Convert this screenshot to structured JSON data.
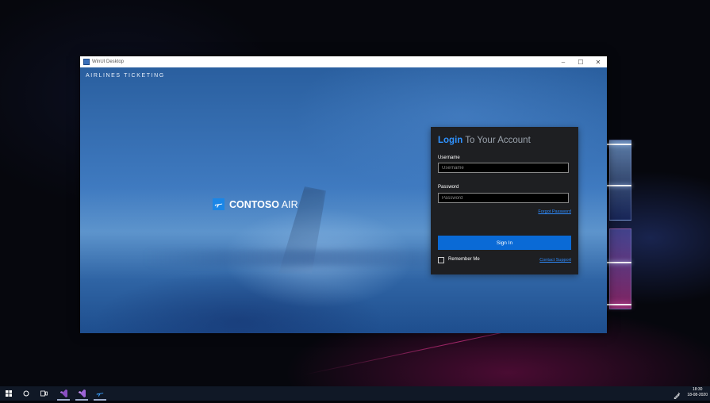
{
  "window": {
    "title": "WinUI Desktop",
    "controls": {
      "minimize": "–",
      "maximize": "☐",
      "close": "✕"
    }
  },
  "hero": {
    "tagline": "AIRLINES TICKETING",
    "brand_main": "CONTOSO",
    "brand_suffix": " AIR"
  },
  "login": {
    "title_accent": "Login",
    "title_rest": " To Your Account",
    "username_label": "Username",
    "username_placeholder": "Username",
    "username_value": "",
    "password_label": "Password",
    "password_placeholder": "Password",
    "password_value": "",
    "forgot_password": "Forgot Password",
    "sign_in": "Sign In",
    "remember_me": "Remember Me",
    "remember_checked": false,
    "contact_support": "Contact Support",
    "accent_color": "#2f92ff",
    "button_color": "#0a6ad6"
  },
  "taskbar": {
    "items": [
      "windows-start-icon",
      "search-icon",
      "task-view-icon",
      "visual-studio-icon",
      "visual-studio-preview-icon",
      "contoso-air-app-icon"
    ],
    "time": "18:30",
    "date": "18-08-2020"
  }
}
